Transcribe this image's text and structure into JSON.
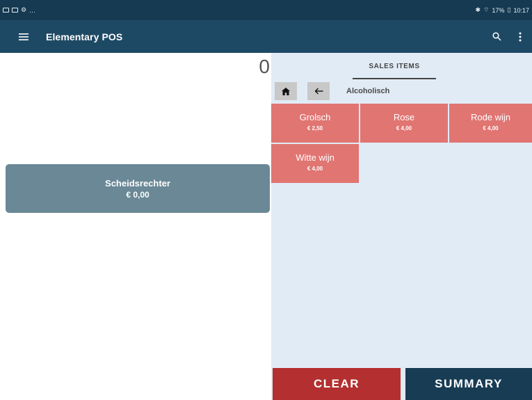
{
  "status": {
    "left_text": "…",
    "right_text": "17%",
    "time": "10:17"
  },
  "appbar": {
    "title": "Elementary POS",
    "icons": [
      "menu-icon",
      "search-icon",
      "more-vert-icon"
    ]
  },
  "order": {
    "total": "0",
    "items": [
      {
        "name": "Scheidsrechter",
        "price": "€ 0,00"
      }
    ]
  },
  "catalog": {
    "tab_label": "SALES ITEMS",
    "breadcrumb": "Alcoholisch",
    "items": [
      {
        "name": "Grolsch",
        "price": "€ 2,50"
      },
      {
        "name": "Rose",
        "price": "€ 4,00"
      },
      {
        "name": "Rode wijn",
        "price": "€ 4,00"
      },
      {
        "name": "Witte wijn",
        "price": "€ 4,00"
      }
    ]
  },
  "actions": {
    "clear_label": "CLEAR",
    "summary_label": "SUMMARY"
  },
  "colors": {
    "appbar": "#1e4964",
    "tile": "#e07572",
    "clear": "#b42f2f",
    "summary": "#173c54",
    "order_card": "#6a8896"
  }
}
